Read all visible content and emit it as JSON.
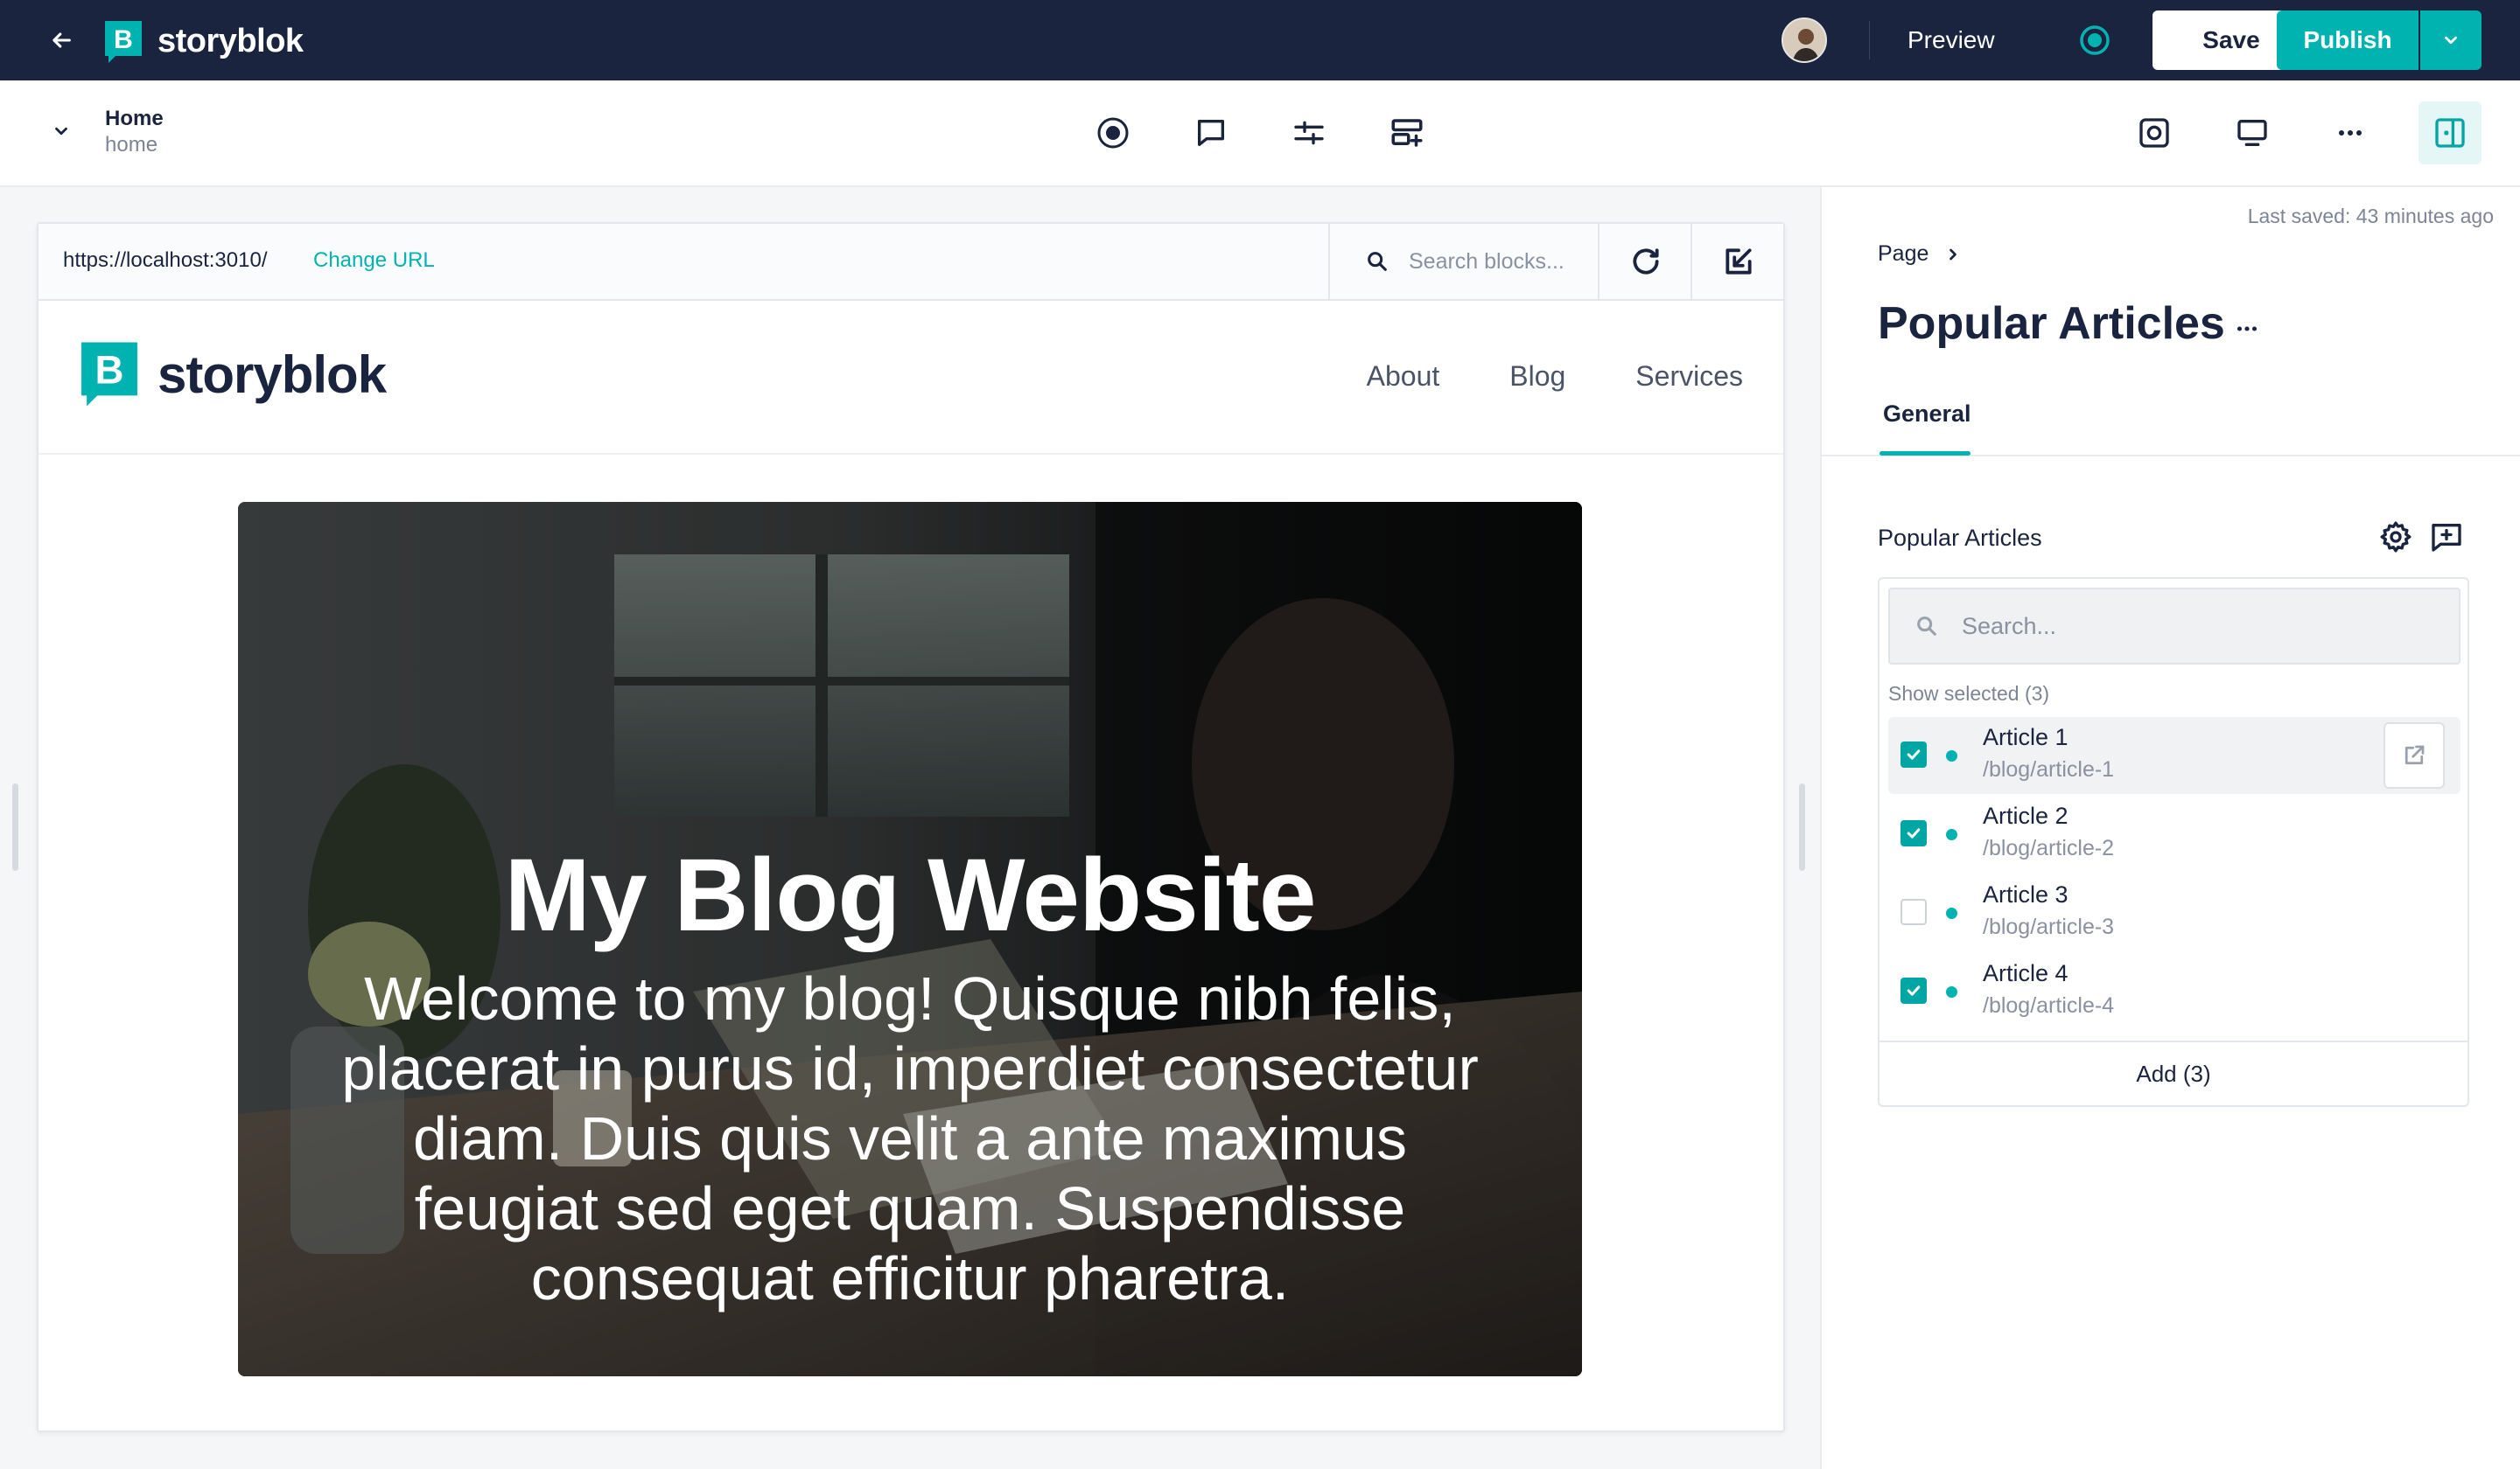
{
  "topbar": {
    "brand": "storyblok",
    "preview_label": "Preview",
    "save_label": "Save",
    "publish_label": "Publish"
  },
  "story": {
    "title": "Home",
    "slug": "home"
  },
  "preview": {
    "url": "https://localhost:3010/",
    "change_url_label": "Change URL",
    "block_search_placeholder": "Search blocks...",
    "site": {
      "brand": "storyblok",
      "nav": [
        "About",
        "Blog",
        "Services"
      ],
      "hero_title": "My Blog Website",
      "hero_body": "Welcome to my blog! Quisque nibh felis, placerat in purus id, imperdiet consectetur diam. Duis quis velit a ante maximus feugiat sed eget quam. Suspendisse consequat efficitur pharetra."
    }
  },
  "panel": {
    "last_saved": "Last saved: 43 minutes ago",
    "breadcrumb": "Page",
    "title": "Popular Articles",
    "tabs": [
      "General"
    ],
    "field_label": "Popular Articles",
    "search_placeholder": "Search...",
    "show_selected": "Show selected (3)",
    "items": [
      {
        "title": "Article 1",
        "path": "/blog/article-1",
        "checked": true
      },
      {
        "title": "Article 2",
        "path": "/blog/article-2",
        "checked": true
      },
      {
        "title": "Article 3",
        "path": "/blog/article-3",
        "checked": false
      },
      {
        "title": "Article 4",
        "path": "/blog/article-4",
        "checked": true
      }
    ],
    "add_label": "Add (3)"
  },
  "colors": {
    "topbar": "#1b243f",
    "accent": "#00b3b0",
    "panel_bg": "#ffffff"
  }
}
